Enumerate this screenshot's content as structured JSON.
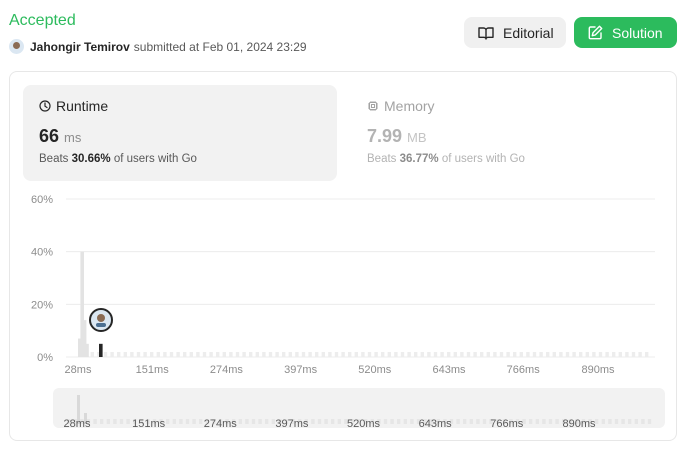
{
  "header": {
    "status": "Accepted",
    "user": "Jahongir Temirov",
    "submitted_text": "submitted at Feb 01, 2024 23:29",
    "editorial_label": "Editorial",
    "solution_label": "Solution",
    "accent_color": "#2cbb5d"
  },
  "runtime": {
    "title": "Runtime",
    "value": "66",
    "unit": "ms",
    "beats_prefix": "Beats",
    "beats_pct": "30.66%",
    "beats_suffix": "of users with Go",
    "icon": "clock-icon"
  },
  "memory": {
    "title": "Memory",
    "value": "7.99",
    "unit": "MB",
    "beats_prefix": "Beats",
    "beats_pct": "36.77%",
    "beats_suffix": "of users with Go",
    "icon": "chip-icon"
  },
  "chart_data": {
    "type": "bar",
    "title": "",
    "xlabel": "",
    "ylabel": "",
    "y_ticks": [
      "60%",
      "40%",
      "20%",
      "0%"
    ],
    "ylim": [
      0,
      60
    ],
    "x_ticks": [
      "28ms",
      "151ms",
      "274ms",
      "397ms",
      "520ms",
      "643ms",
      "766ms",
      "890ms"
    ],
    "highlight_value": 66,
    "bars": [
      {
        "runtime": 28,
        "pct": 7
      },
      {
        "runtime": 32,
        "pct": 40
      },
      {
        "runtime": 36,
        "pct": 14
      },
      {
        "runtime": 40,
        "pct": 5
      },
      {
        "runtime": 66,
        "pct": 5
      }
    ],
    "grid": true
  }
}
